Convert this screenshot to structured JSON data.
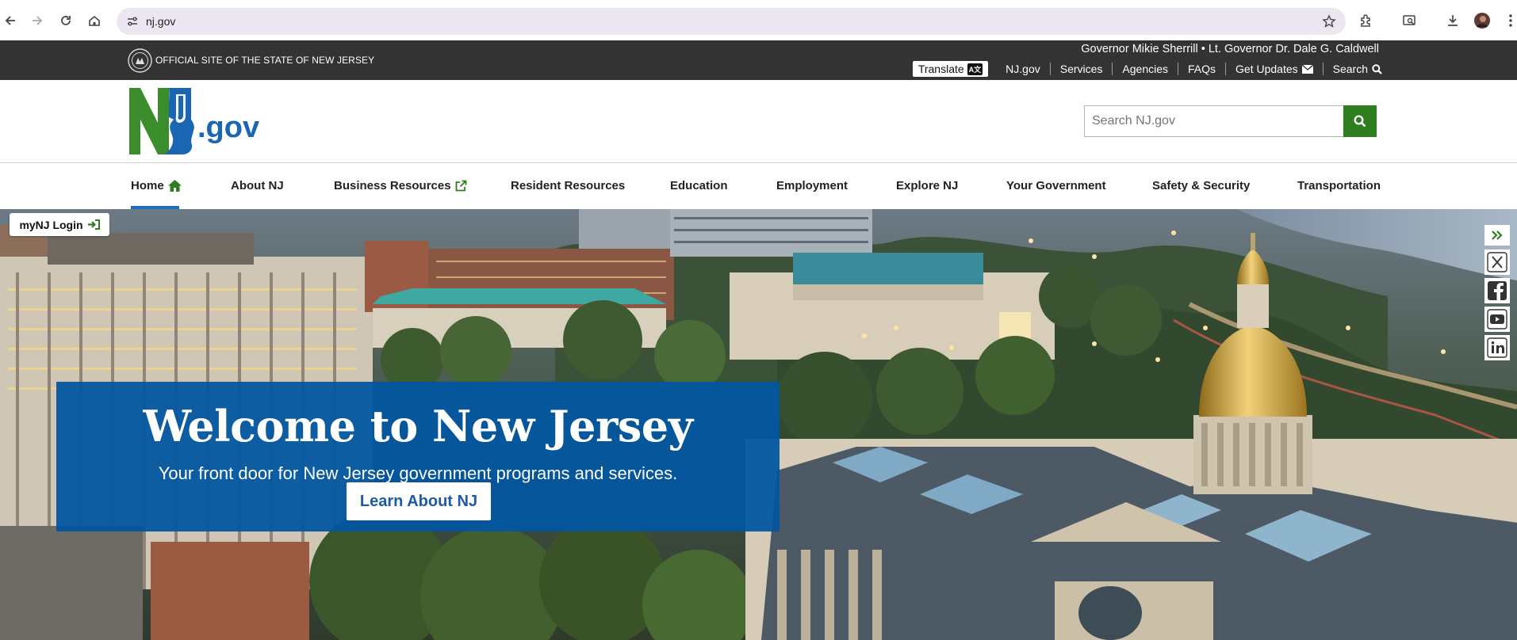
{
  "browser": {
    "url": "nj.gov"
  },
  "govbar": {
    "official_site": "OFFICIAL SITE OF THE STATE OF NEW JERSEY",
    "governor": "Governor Mikie Sherrill • Lt. Governor Dr. Dale G. Caldwell",
    "translate_label": "Translate",
    "translate_badge": "A文",
    "links": [
      "NJ.gov",
      "Services",
      "Agencies",
      "FAQs",
      "Get Updates",
      "Search"
    ]
  },
  "header": {
    "logo_text": ".gov",
    "search_placeholder": "Search NJ.gov"
  },
  "nav": {
    "items": [
      "Home",
      "About NJ",
      "Business Resources",
      "Resident Resources",
      "Education",
      "Employment",
      "Explore NJ",
      "Your Government",
      "Safety & Security",
      "Transportation"
    ],
    "active": "Home"
  },
  "hero": {
    "mynj_label": "myNJ Login",
    "title": "Welcome to New Jersey",
    "subtitle": "Your front door for New Jersey government programs and services.",
    "cta": "Learn About NJ"
  },
  "social": [
    "x-icon",
    "facebook-icon",
    "youtube-icon",
    "linkedin-icon"
  ],
  "colors": {
    "govbar": "#333333",
    "search_button": "#2e7d1e",
    "welcome_box": "#0256a0",
    "nav_active_underline": "#1f6fbf",
    "logo_green": "#3a8d2a",
    "logo_blue": "#1a66b3"
  }
}
